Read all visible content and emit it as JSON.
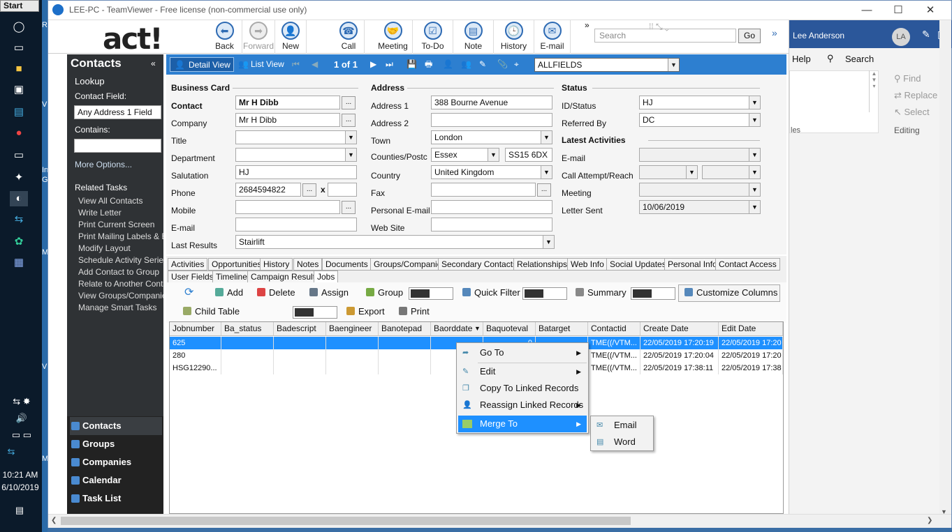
{
  "taskbar": {
    "start": "Start",
    "time": "10:21 AM",
    "date": "6/10/2019",
    "desktop_fragments": [
      "Re",
      "V",
      "In",
      "Gra",
      "Mo",
      "V",
      "Ma"
    ]
  },
  "window": {
    "title": "LEE-PC - TeamViewer - Free license (non-commercial use only)"
  },
  "toolbar": {
    "logo": "act!",
    "buttons": [
      {
        "label": "Back",
        "icon": "back-arrow-icon",
        "glyph": "⬅"
      },
      {
        "label": "Forward",
        "icon": "forward-arrow-icon",
        "glyph": "➡"
      },
      {
        "label": "New",
        "icon": "new-contact-icon",
        "glyph": "👤"
      },
      {
        "label": "Call",
        "icon": "phone-icon",
        "glyph": "☎"
      },
      {
        "label": "Meeting",
        "icon": "handshake-icon",
        "glyph": "🤝"
      },
      {
        "label": "To-Do",
        "icon": "checkbox-icon",
        "glyph": "☑"
      },
      {
        "label": "Note",
        "icon": "note-icon",
        "glyph": "▤"
      },
      {
        "label": "History",
        "icon": "clock-icon",
        "glyph": "🕒"
      },
      {
        "label": "E-mail",
        "icon": "envelope-icon",
        "glyph": "✉"
      }
    ],
    "search_placeholder": "Search",
    "go": "Go"
  },
  "office": {
    "user": "Lee Anderson",
    "initials": "LA",
    "help": "Help",
    "search": "Search",
    "find": "Find",
    "replace": "Replace",
    "select": "Select",
    "styles_fragment": "les",
    "editing": "Editing"
  },
  "sidebar": {
    "title": "Contacts",
    "lookup": "Lookup",
    "contact_field_label": "Contact Field:",
    "contact_field_value": "Any Address 1 Field",
    "contains_label": "Contains:",
    "more_options": "More Options...",
    "related_tasks_title": "Related Tasks",
    "related_tasks": [
      "View All Contacts",
      "Write Letter",
      "Print Current Screen",
      "Print Mailing Labels & E",
      "Modify Layout",
      "Schedule Activity Series",
      "Add Contact to Group",
      "Relate to Another Conta",
      "View Groups/Companies",
      "Manage Smart Tasks"
    ],
    "nav": [
      "Contacts",
      "Groups",
      "Companies",
      "Calendar",
      "Task List"
    ]
  },
  "detailbar": {
    "detail_view": "Detail View",
    "list_view": "List View",
    "record_pos": "1 of 1",
    "layout": "ALLFIELDS"
  },
  "form": {
    "business_card": "Business Card",
    "address_title": "Address",
    "status_title": "Status",
    "latest_title": "Latest Activities",
    "contact_label": "Contact",
    "contact": "Mr H Dibb",
    "company_label": "Company",
    "company": "Mr H Dibb",
    "title_label": "Title",
    "department_label": "Department",
    "salutation_label": "Salutation",
    "salutation": "HJ",
    "phone_label": "Phone",
    "phone": "2684594822",
    "mobile_label": "Mobile",
    "email_label": "E-mail",
    "last_results_label": "Last Results",
    "last_results": "Stairlift",
    "address1_label": "Address 1",
    "address1": "388 Bourne Avenue",
    "address2_label": "Address 2",
    "town_label": "Town",
    "town": "London",
    "counties_label": "Counties/Postc",
    "county": "Essex",
    "postcode": "SS15 6DX",
    "country_label": "Country",
    "country": "United Kingdom",
    "fax_label": "Fax",
    "personal_email_label": "Personal E-mail",
    "website_label": "Web Site",
    "id_status_label": "ID/Status",
    "id_status": "HJ",
    "referred_label": "Referred By",
    "referred": "DC",
    "la_email_label": "E-mail",
    "call_attempt_label": "Call Attempt/Reach",
    "meeting_label": "Meeting",
    "letter_sent_label": "Letter Sent",
    "letter_sent": "10/06/2019",
    "x_label": "x"
  },
  "tabs_row1": [
    "Activities",
    "Opportunities",
    "History",
    "Notes",
    "Documents",
    "Groups/Companies",
    "Secondary Contacts",
    "Relationships",
    "Web Info",
    "Social Updates",
    "Personal Info",
    "Contact Access"
  ],
  "tabs_row2": [
    "User Fields",
    "Timeline",
    "Campaign Results",
    "Jobs"
  ],
  "jobs_toolbar": {
    "add": "Add",
    "delete": "Delete",
    "assign": "Assign",
    "group": "Group",
    "quick_filter": "Quick Filter",
    "summary": "Summary",
    "customize": "Customize Columns",
    "child_table": "Child Table",
    "export": "Export",
    "print": "Print"
  },
  "grid": {
    "columns": [
      "Jobnumber",
      "Ba_status",
      "Badescript",
      "Baengineer",
      "Banotepad",
      "Baorddate",
      "Baquoteval",
      "Batarget",
      "Contactid",
      "Create Date",
      "Edit Date"
    ],
    "rows": [
      {
        "job": "625",
        "quote": "0",
        "contact": "TME((/VTM...",
        "created": "22/05/2019 17:20:19",
        "edited": "22/05/2019 17:20"
      },
      {
        "job": "280",
        "quote": "",
        "contact": "TME((/VTM...",
        "created": "22/05/2019 17:20:04",
        "edited": "22/05/2019 17:20"
      },
      {
        "job": "HSG12290...",
        "quote": "",
        "contact": "TME((/VTM...",
        "created": "22/05/2019 17:38:11",
        "edited": "22/05/2019 17:38"
      }
    ]
  },
  "context_menu": {
    "items": [
      "Go To",
      "Edit",
      "Copy To Linked Records",
      "Reassign Linked Records",
      "Merge To"
    ],
    "submenu": [
      "Email",
      "Word"
    ]
  },
  "colors": {
    "accent": "#2d7fd0",
    "selection": "#1e90ff",
    "panel": "#2f3235",
    "office_blue": "#2b579a"
  }
}
